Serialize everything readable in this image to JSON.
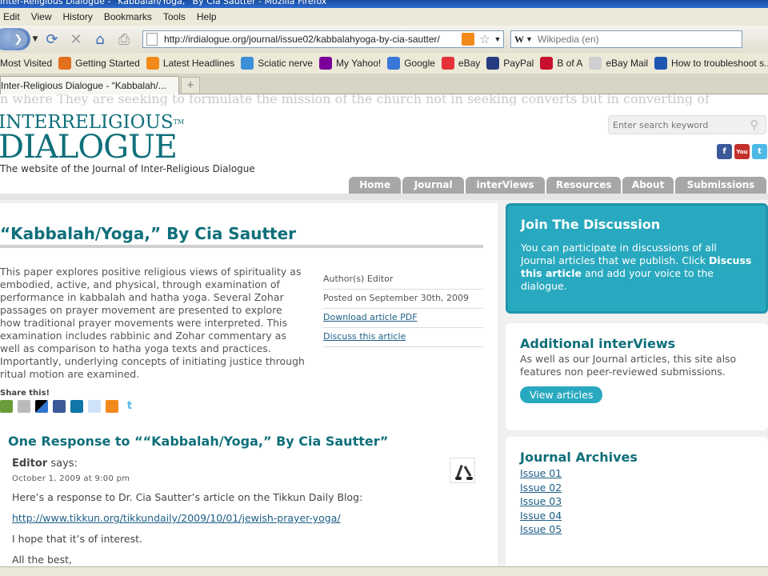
{
  "window": {
    "title": "Inter-Religious Dialogue - “Kabbalah/Yoga,” By Cia Sautter - Mozilla Firefox"
  },
  "menu": [
    "Edit",
    "View",
    "History",
    "Bookmarks",
    "Tools",
    "Help"
  ],
  "toolbar": {
    "url": "http://irdialogue.org/journal/issue02/kabbalahyoga-by-cia-sautter/",
    "search_engine_letter": "W",
    "search_placeholder": "Wikipedia (en)"
  },
  "bookmarks": [
    {
      "label": "Most Visited",
      "icon": "most-visited-icon",
      "color": "#5b7fb8"
    },
    {
      "label": "Getting Started",
      "icon": "firefox-icon",
      "color": "#e3701e"
    },
    {
      "label": "Latest Headlines",
      "icon": "rss-icon",
      "color": "#f28a1b"
    },
    {
      "label": "Sciatic nerve",
      "icon": "sciatic-icon",
      "color": "#3d8fd6"
    },
    {
      "label": "My Yahoo!",
      "icon": "yahoo-icon",
      "color": "#7b0099"
    },
    {
      "label": "Google",
      "icon": "google-icon",
      "color": "#3a77d8"
    },
    {
      "label": "eBay",
      "icon": "ebay-icon",
      "color": "#e53238"
    },
    {
      "label": "PayPal",
      "icon": "paypal-icon",
      "color": "#253b80"
    },
    {
      "label": "B of A",
      "icon": "bofa-icon",
      "color": "#c8102e"
    },
    {
      "label": "eBay Mail",
      "icon": "page-icon",
      "color": "#cfcfcf"
    },
    {
      "label": "How to troubleshoot s...",
      "icon": "msdn-icon",
      "color": "#1f56b0"
    }
  ],
  "tab": {
    "label": "Inter-Religious Dialogue - “Kabbalah/...",
    "new_tab": "+"
  },
  "site": {
    "ghost_text": "n where They are seeking to formulate the mission of the church not in seeking converts but in converting of",
    "logo_line1": "INTERRELIGIOUS",
    "logo_tm": "TM",
    "logo_line2": "DIALOGUE",
    "tagline": "The website of the Journal of Inter-Religious Dialogue",
    "search_placeholder": "Enter search keyword",
    "nav": [
      "Home",
      "Journal",
      "interViews",
      "Resources",
      "About",
      "Submissions"
    ]
  },
  "article": {
    "title": "“Kabbalah/Yoga,” By Cia Sautter",
    "abstract": "This paper explores positive religious views of spirituality as embodied, active, and physical, through examination of performance in kabbalah and hatha yoga. Several Zohar passages on prayer movement are presented to explore how traditional prayer movements were interpreted. This examination includes rabbinic and Zohar commentary as well as comparison to hatha yoga texts and practices. Importantly, underlying concepts of initiating justice through ritual motion are examined.",
    "author": "Author(s) Editor",
    "posted": "Posted on September 30th, 2009",
    "download_link": "Download article PDF",
    "discuss_link": "Discuss this article",
    "share_label": "Share this!"
  },
  "responses": {
    "title": "One Response to ““Kabbalah/Yoga,” By Cia Sautter”",
    "author": "Editor",
    "says": "says:",
    "date": "October 1, 2009 at 9:00 pm",
    "p1": "Here’s a response to Dr. Cia Sautter’s article on the Tikkun Daily Blog:",
    "link": "http://www.tikkun.org/tikkundaily/2009/10/01/jewish-prayer-yoga/",
    "p2": "I hope that it’s of interest.",
    "p3": "All the best,"
  },
  "sidebar": {
    "join_title": "Join The Discussion",
    "join_text_a": "You can participate in discussions of all Journal articles that we publish. Click ",
    "join_text_bold": "Discuss this article",
    "join_text_b": " and add your voice to the dialogue.",
    "interviews_title": "Additional interViews",
    "interviews_text": "As well as our Journal articles, this site also features non peer-reviewed submissions.",
    "interviews_button": "View articles",
    "archives_title": "Journal Archives",
    "issues": [
      "Issue 01",
      "Issue 02",
      "Issue 03",
      "Issue 04",
      "Issue 05"
    ]
  },
  "colors": {
    "accent": "#0f6f7a",
    "panel": "#29a9bf",
    "nav": "#a7a7a7"
  }
}
